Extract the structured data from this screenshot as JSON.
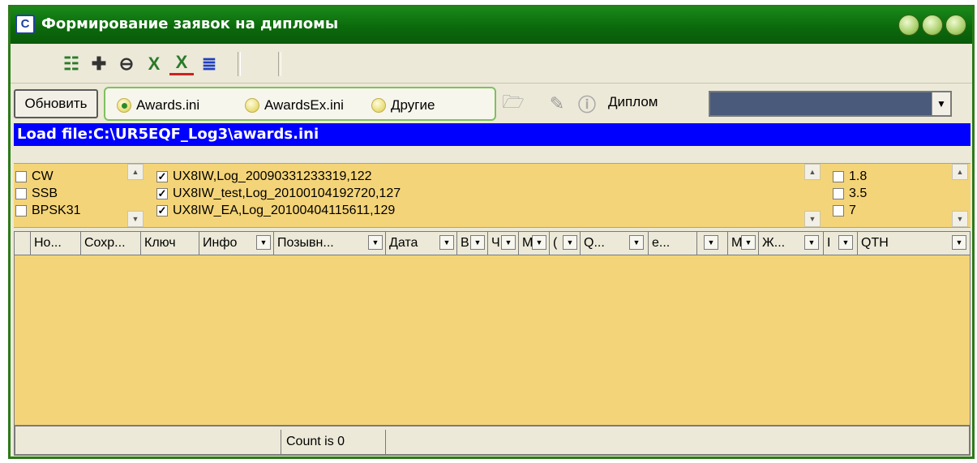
{
  "window": {
    "title": "Формирование заявок на дипломы",
    "app_icon_glyph": "C"
  },
  "toolbar": {
    "icons": [
      "tree-list-icon",
      "add-icon",
      "link-icon",
      "excel-x-icon",
      "excel-x-red-icon",
      "list-lines-icon"
    ]
  },
  "controls": {
    "refresh_label": "Обновить",
    "radios": [
      {
        "label": "Awards.ini",
        "selected": true
      },
      {
        "label": "AwardsEx.ini",
        "selected": false
      },
      {
        "label": "Другие",
        "selected": false
      }
    ],
    "diplom_label": "Диплом",
    "diplom_value": ""
  },
  "load_file": "Load file:C:\\UR5EQF_Log3\\awards.ini",
  "modes": [
    "CW",
    "SSB",
    "BPSK31"
  ],
  "logs": [
    {
      "label": "UX8IW,Log_20090331233319,122",
      "checked": true
    },
    {
      "label": "UX8IW_test,Log_20100104192720,127",
      "checked": true
    },
    {
      "label": "UX8IW_EA,Log_20100404115611,129",
      "checked": true
    }
  ],
  "bands": [
    "1.8",
    "3.5",
    "7"
  ],
  "grid": {
    "columns": [
      "Но...",
      "Сохр...",
      "Ключ",
      "Инфо",
      "Позывн...",
      "Дата",
      "В",
      "Ч",
      "М",
      "(",
      "Q...",
      "e...",
      "",
      "М",
      "Ж...",
      "I",
      "QTH"
    ]
  },
  "status": {
    "count_text": "Count is 0"
  },
  "colors": {
    "title_green": "#0b6a0b",
    "load_bar_blue": "#0000ff",
    "list_bg": "#f4d478"
  }
}
